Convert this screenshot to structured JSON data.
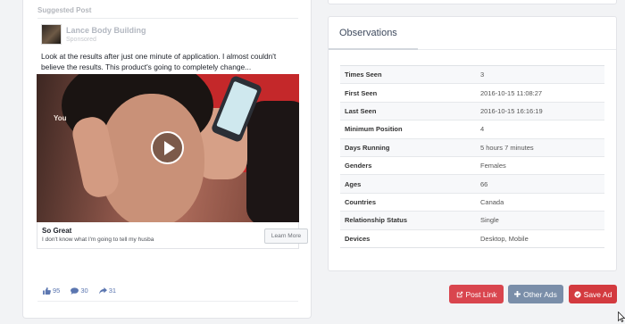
{
  "post": {
    "suggested_label": "Suggested Post",
    "page_name": "Lance Body Building",
    "sponsored_label": "Sponsored",
    "text": "Look at the results after just one minute of application. I almost couldn't believe the results. This product's going to completely change...",
    "video_overlay_text": "You",
    "link_title": "So Great",
    "link_description": "I don't know what I'm going to tell my husba",
    "cta_label": "Learn More",
    "reactions": {
      "likes": "95",
      "comments": "30",
      "shares": "31"
    }
  },
  "observations": {
    "title": "Observations",
    "rows": [
      {
        "label": "Times Seen",
        "value": "3"
      },
      {
        "label": "First Seen",
        "value": "2016-10-15 11:08:27"
      },
      {
        "label": "Last Seen",
        "value": "2016-10-15 16:16:19"
      },
      {
        "label": "Minimum Position",
        "value": "4"
      },
      {
        "label": "Days Running",
        "value": "5 hours 7 minutes"
      },
      {
        "label": "Genders",
        "value": "Females"
      },
      {
        "label": "Ages",
        "value": "66"
      },
      {
        "label": "Countries",
        "value": "Canada"
      },
      {
        "label": "Relationship Status",
        "value": "Single"
      },
      {
        "label": "Devices",
        "value": "Desktop, Mobile"
      }
    ]
  },
  "actions": {
    "post_link": "Post Link",
    "other_ads": "Other Ads",
    "save_ad": "Save Ad"
  },
  "colors": {
    "facebook_blue": "#5b76b0",
    "post_link_button": "#d9454e",
    "other_ads_button": "#7a8ea9",
    "save_ad_button": "#d33a3f"
  }
}
